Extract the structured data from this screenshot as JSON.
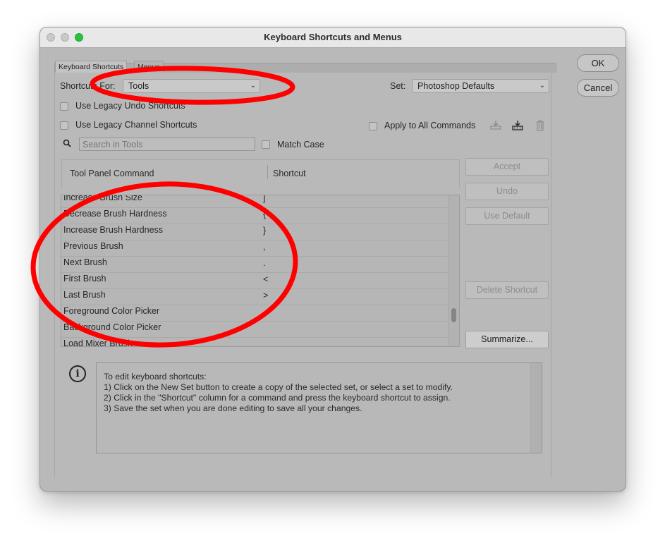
{
  "window": {
    "title": "Keyboard Shortcuts and Menus"
  },
  "tabs": [
    {
      "label": "Keyboard Shortcuts",
      "active": true
    },
    {
      "label": "Menus",
      "active": false
    }
  ],
  "shortcuts_for": {
    "label": "Shortcuts For:",
    "value": "Tools"
  },
  "set": {
    "label": "Set:",
    "value": "Photoshop Defaults"
  },
  "options": {
    "legacy_undo": {
      "label": "Use Legacy Undo Shortcuts",
      "checked": false
    },
    "legacy_channel": {
      "label": "Use Legacy Channel Shortcuts",
      "checked": false
    },
    "apply_all": {
      "label": "Apply to All Commands",
      "checked": false
    },
    "match_case": {
      "label": "Match Case",
      "checked": false
    }
  },
  "search": {
    "placeholder": "Search in Tools"
  },
  "table": {
    "columns": [
      "Tool Panel Command",
      "Shortcut"
    ],
    "rows": [
      {
        "command": "Increase Brush Size",
        "shortcut": "]"
      },
      {
        "command": "Decrease Brush Hardness",
        "shortcut": "{"
      },
      {
        "command": "Increase Brush Hardness",
        "shortcut": "}"
      },
      {
        "command": "Previous Brush",
        "shortcut": ","
      },
      {
        "command": "Next Brush",
        "shortcut": "."
      },
      {
        "command": "First Brush",
        "shortcut": "<"
      },
      {
        "command": "Last Brush",
        "shortcut": ">"
      },
      {
        "command": "Foreground Color Picker",
        "shortcut": ""
      },
      {
        "command": "Background Color Picker",
        "shortcut": ""
      },
      {
        "command": "Load Mixer Brush",
        "shortcut": ""
      }
    ],
    "scroll_position": 0.75
  },
  "side_buttons": {
    "accept": "Accept",
    "undo": "Undo",
    "use_default": "Use Default",
    "delete_shortcut": "Delete Shortcut",
    "summarize": "Summarize..."
  },
  "dialog_buttons": {
    "ok": "OK",
    "cancel": "Cancel"
  },
  "info": {
    "lines": [
      "To edit keyboard shortcuts:",
      "1) Click on the New Set button to create a copy of the selected set, or select a set to modify.",
      "2) Click in the \"Shortcut\" column for a command and press the keyboard shortcut to assign.",
      "3) Save the set when you are done editing to save all your changes."
    ]
  },
  "icons": [
    "search-icon",
    "info-icon",
    "save-set-icon",
    "new-set-icon",
    "delete-set-icon",
    "chevron-down-icon"
  ],
  "annotation_color": "#ff0000"
}
